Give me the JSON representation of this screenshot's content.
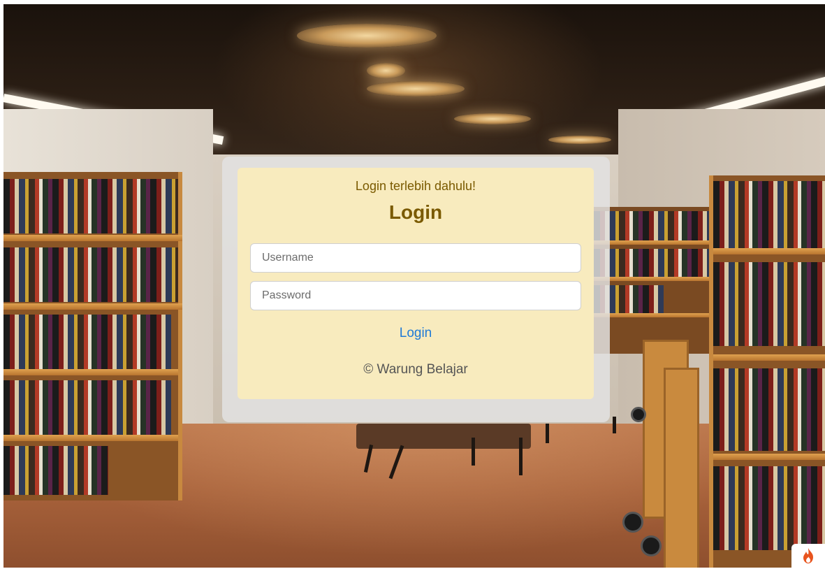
{
  "login": {
    "subtitle": "Login terlebih dahulu!",
    "title": "Login",
    "username_placeholder": "Username",
    "password_placeholder": "Password",
    "submit_label": "Login",
    "copyright": "© Warung Belajar"
  },
  "colors": {
    "card_panel": "#f8ebbe",
    "card_frame": "#e2e2e2",
    "heading": "#7a5a00",
    "link": "#1f7ad6",
    "footer_text": "#555555",
    "badge_icon": "#e8541e"
  },
  "icons": {
    "badge": "flame-icon"
  }
}
